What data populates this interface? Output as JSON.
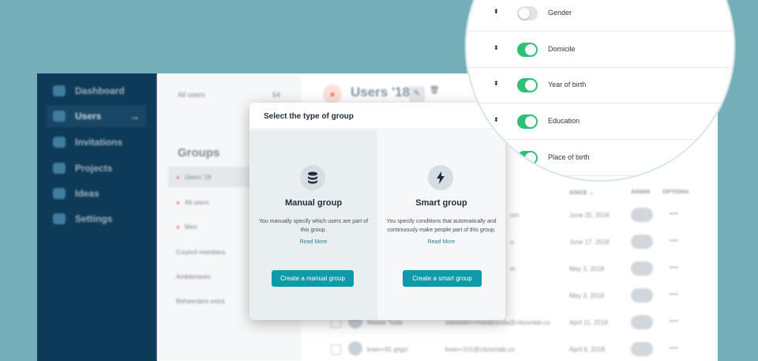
{
  "sidebar": {
    "items": [
      {
        "label": "Dashboard"
      },
      {
        "label": "Users",
        "arrow": "→"
      },
      {
        "label": "Invitations"
      },
      {
        "label": "Projects"
      },
      {
        "label": "Ideas"
      },
      {
        "label": "Settings"
      }
    ]
  },
  "groups": {
    "all_users_label": "All users",
    "all_users_count": "54",
    "title": "Groups",
    "items": [
      {
        "label": "Users '18"
      },
      {
        "label": "All users"
      },
      {
        "label": "Men"
      },
      {
        "label": "Council members"
      },
      {
        "label": "Ambtenaren"
      },
      {
        "label": "Beheerders extra"
      }
    ]
  },
  "main": {
    "title": "Users '18",
    "columns": {
      "since": "SINCE ⌄",
      "admin": "ADMIN",
      "options": "OPTIONS"
    },
    "rows": [
      {
        "name": "",
        "email": "om",
        "since": "June 20, 2018"
      },
      {
        "name": "",
        "email": "o",
        "since": "June 17, 2018"
      },
      {
        "name": "",
        "email": "m",
        "since": "May 3, 2018"
      },
      {
        "name": "",
        "email": "",
        "since": "May 3, 2018"
      },
      {
        "name": "Master Yoda",
        "email": "sebastien+masteryoda@citizenlab.co",
        "since": "April 11, 2018"
      },
      {
        "name": "koen+91 grigri",
        "email": "koen+101@citizenlab.co",
        "since": "April 6, 2018"
      }
    ]
  },
  "modal": {
    "title": "Select the type of group",
    "manual": {
      "title": "Manual group",
      "description": "You manually specify which users are part of this group.",
      "read_more": "Read More",
      "button": "Create a manual group"
    },
    "smart": {
      "title": "Smart group",
      "description": "You specify conditions that automatically and continuously make people part of this group.",
      "read_more": "Read More",
      "button": "Create a smart group"
    }
  },
  "fields": [
    {
      "label": "Gender",
      "enabled": false
    },
    {
      "label": "Domicile",
      "enabled": true
    },
    {
      "label": "Year of birth",
      "enabled": true
    },
    {
      "label": "Education",
      "enabled": true
    },
    {
      "label": "Place of birth",
      "enabled": true
    }
  ],
  "colors": {
    "accent": "#0f9aa9",
    "toggle_on": "#2fbf75",
    "sidebar": "#0d3a57",
    "background": "#74aeb9"
  }
}
